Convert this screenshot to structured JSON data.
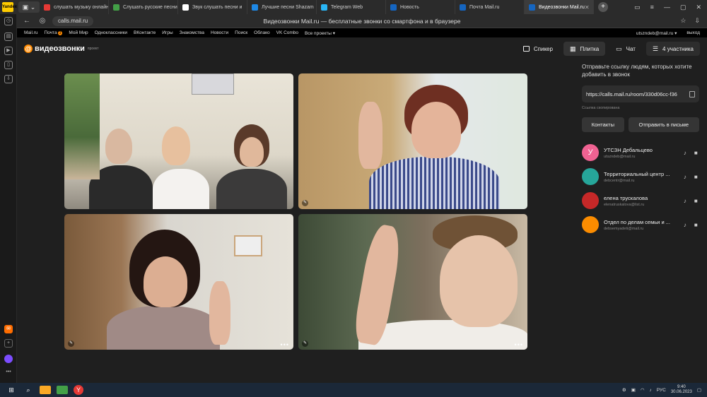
{
  "browser": {
    "brand": "Yandex",
    "tabs": [
      {
        "label": "слушать музыку онлайн",
        "color": "#e53935"
      },
      {
        "label": "Слушать русские песни",
        "color": "#43a047"
      },
      {
        "label": "Звук слушать песни и",
        "color": "#ffffff"
      },
      {
        "label": "Лучшие песни Shazam",
        "color": "#1e88e5"
      },
      {
        "label": "Telegram Web",
        "color": "#29b6f6"
      },
      {
        "label": "Новость",
        "color": "#1565c0"
      },
      {
        "label": "Почта Mail.ru",
        "color": "#1565c0"
      },
      {
        "label": "Видеозвонки Mail.ru",
        "color": "#1565c0",
        "active": true
      }
    ],
    "url": "calls.mail.ru",
    "page_title": "Видеозвонки Mail.ru — бесплатные звонки со смартфона и в браузере"
  },
  "portal": {
    "links": [
      "Mail.ru",
      "Почта",
      "Мой Мир",
      "Одноклассники",
      "ВКонтакте",
      "Игры",
      "Знакомства",
      "Новости",
      "Поиск",
      "Облако",
      "VK Combo",
      "Все проекты ▾"
    ],
    "mail_badge": "3",
    "user": "utszndeb@mail.ru ▾",
    "logout": "выход"
  },
  "app": {
    "logo": "видеозвонки",
    "logo_sub": "проект",
    "buttons": {
      "speaker": "Спикер",
      "tile": "Плитка",
      "chat": "Чат",
      "participants": "4 участника"
    }
  },
  "panel": {
    "invite_text": "Отправьте ссылку людям, которых хотите добавить в звонок",
    "link": "https://calls.mail.ru/room/330d06cc-f36",
    "copied": "Ссылка скопирована",
    "contacts_btn": "Контакты",
    "send_btn": "Отправить в письме",
    "participants": [
      {
        "name": "УТСЗН Дебальцево",
        "email": "utszndeb@mail.ru",
        "initial": "У",
        "color": "#f06292"
      },
      {
        "name": "Территориальный центр ...",
        "email": "debcentr@mail.ru",
        "initial": "",
        "color": "#26a69a"
      },
      {
        "name": "елена трускалова",
        "email": "elenatruskalova@list.ru",
        "initial": "",
        "color": "#c62828"
      },
      {
        "name": "Отдел по делам семьи и ...",
        "email": "debsemyadeti@mail.ru",
        "initial": "",
        "color": "#fb8c00"
      }
    ]
  },
  "taskbar": {
    "lang": "РУС",
    "time": "9:40",
    "date": "30.06.2023"
  }
}
